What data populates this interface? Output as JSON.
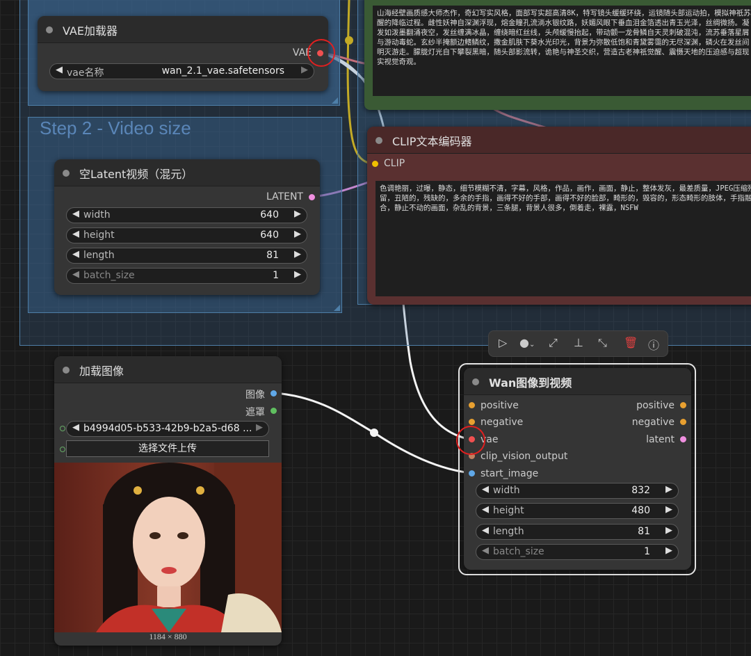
{
  "groups": {
    "step2_title": "Step 2 - Video size"
  },
  "vae_loader": {
    "title": "VAE加载器",
    "output": "VAE",
    "widget_label": "vae名称",
    "widget_value": "wan_2.1_vae.safetensors"
  },
  "latent_node": {
    "title": "空Latent视频（混元）",
    "output": "LATENT",
    "widgets": [
      {
        "label": "width",
        "value": "640"
      },
      {
        "label": "height",
        "value": "640"
      },
      {
        "label": "length",
        "value": "81"
      },
      {
        "label": "batch_size",
        "value": "1"
      }
    ]
  },
  "positive_text": "山海经壁画质感大师杰作，奇幻写实风格，面部写实超高清8K，特写镜头缓缓环绕，运镜随头部运动拍，模拟神祇苏醒的降临过程。雌性妖神自深渊浮现，熔金瞳孔流淌水银纹路，妖媚风眼下垂血泪金箔透出青玉光泽，丝绸微扬。凝发如泼墨翻涌夜空，发丝缠满冰晶，缠绕暗红丝线，头颅缓慢抬起，带动颤一龙骨鳞自天灵刺破混沌，流苏垂落星屑与游动毒蛇。玄纱半掩额边鳍鳞纹，撒金肌肤下葵水光印光，背景为弥散低饱和青黛雾霭的无尽深渊，磷火在发丝间明灭游走。朦胧灯光自下攀裂黑暗，随头部影流转，诡艳与神圣交织，营造古老神祇觉醒、震慑天地的压迫感与超现实视觉奇观。",
  "clip_node": {
    "title": "CLIP文本编码器",
    "input": "CLIP",
    "text": "色调艳丽，过曝，静态，细节模糊不清，字幕，风格，作品，画作，画面，静止，整体发灰，最差质量，JPEG压缩残留，丑陋的，残缺的，多余的手指，画得不好的手部，画得不好的脸部，畸形的，毁容的，形态畸形的肢体，手指融合，静止不动的画面，杂乱的背景，三条腿，背景人很多，倒着走，裸露，NSFW"
  },
  "load_image": {
    "title": "加载图像",
    "outputs": [
      "图像",
      "遮罩"
    ],
    "filename": "b4994d05-b533-42b9-b2a5-d68 ...",
    "upload_label": "选择文件上传",
    "image_size": "1184 × 880"
  },
  "wan_node": {
    "title": "Wan图像到视频",
    "inputs": [
      {
        "label": "positive",
        "color": "#e8a030"
      },
      {
        "label": "negative",
        "color": "#e8a030"
      },
      {
        "label": "vae",
        "color": "#f05050"
      },
      {
        "label": "clip_vision_output",
        "color": "#c08060"
      },
      {
        "label": "start_image",
        "color": "#60a8e8"
      }
    ],
    "outputs": [
      {
        "label": "positive",
        "color": "#e8a030"
      },
      {
        "label": "negative",
        "color": "#e8a030"
      },
      {
        "label": "latent",
        "color": "#f090e0"
      }
    ],
    "widgets": [
      {
        "label": "width",
        "value": "832"
      },
      {
        "label": "height",
        "value": "480"
      },
      {
        "label": "length",
        "value": "81"
      },
      {
        "label": "batch_size",
        "value": "1"
      }
    ]
  },
  "toolbar": {
    "icons": [
      "play-icon",
      "color-dot-icon",
      "bypass-icon",
      "pin-icon",
      "collapse-icon",
      "delete-icon",
      "help-icon"
    ]
  },
  "colors": {
    "vae_link": "#f05050",
    "clip_link": "#f0c000",
    "latent_link": "#f090e0",
    "image_link": "#ffffff",
    "positive_node": "#3a5a34",
    "negative_node": "#5a3030"
  }
}
